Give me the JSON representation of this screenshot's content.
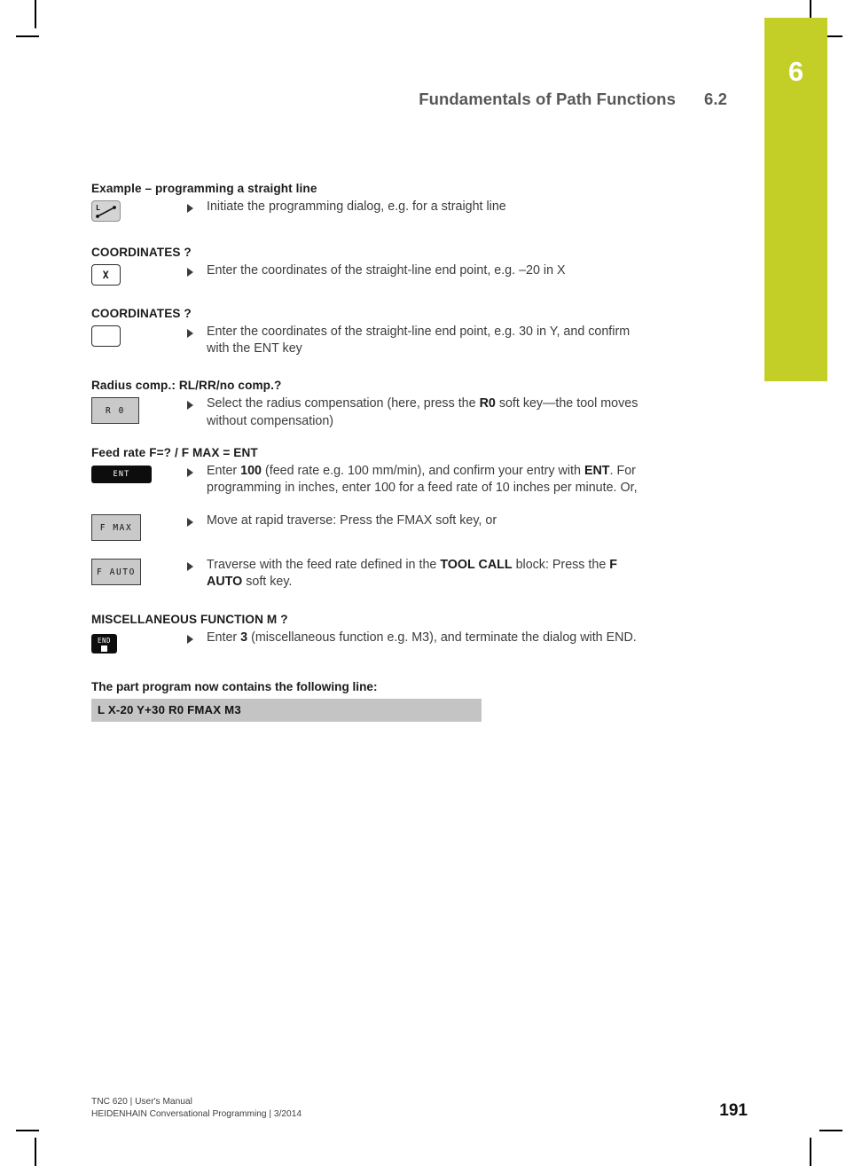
{
  "page": {
    "chapter_number": "6",
    "accent_color": "#c3ce26",
    "page_number": "191"
  },
  "header": {
    "title": "Fundamentals of Path Functions",
    "section": "6.2"
  },
  "content": {
    "example_heading": "Example – programming a straight line",
    "steps": [
      {
        "key": "straight-line-key",
        "key_label": "L",
        "text_html": "Initiate the programming dialog, e.g. for a straight line"
      }
    ],
    "dialogs": [
      {
        "heading": "COORDINATES ?",
        "key": "x-axis-key",
        "key_label": "X",
        "text_html": "Enter the coordinates of the straight-line end point, e.g. –20 in X"
      },
      {
        "heading": "COORDINATES ?",
        "key": "blank-axis-key",
        "key_label": "",
        "text_html": "Enter the coordinates of the straight-line end point, e.g. 30 in Y, and confirm with the ENT key"
      },
      {
        "heading": "Radius comp.: RL/RR/no comp.?",
        "key": "r0-soft-key",
        "key_label": "R 0",
        "text_html": "Select the radius compensation (here, press the <b>R0</b> soft key—the tool moves without compensation)"
      }
    ],
    "feed_rate": {
      "heading": "Feed rate F=? / F MAX = ENT",
      "items": [
        {
          "key": "ent-key",
          "key_label": "ENT",
          "text_html": "Enter <b>100</b> (feed rate e.g. 100 mm/min), and confirm your entry with <b>ENT</b>. For programming in inches, enter 100 for a feed rate of 10 inches per minute. Or,"
        },
        {
          "key": "fmax-soft-key",
          "key_label": "F MAX",
          "text_html": "Move at rapid traverse: Press the FMAX soft key, or"
        },
        {
          "key": "fauto-soft-key",
          "key_label": "F AUTO",
          "text_html": "Traverse with the feed rate defined in the <b>TOOL CALL</b> block: Press the <b>F AUTO</b> soft key."
        }
      ]
    },
    "misc_function": {
      "heading": "MISCELLANEOUS FUNCTION M ?",
      "key": "end-key",
      "key_label": "END",
      "text_html": "Enter <b>3</b> (miscellaneous function e.g. M3), and terminate the dialog with END."
    },
    "program": {
      "heading": "The part program now contains the following line:",
      "line": "L X-20 Y+30 R0 FMAX M3"
    }
  },
  "footer": {
    "line1": "TNC 620 | User's Manual",
    "line2": "HEIDENHAIN Conversational Programming | 3/2014"
  }
}
